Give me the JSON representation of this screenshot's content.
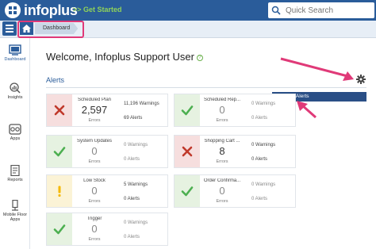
{
  "header": {
    "logo_text": "infoplus",
    "get_started": ">> Get Started",
    "search_placeholder": "Quick Search"
  },
  "breadcrumb": {
    "current": "Dashboard"
  },
  "sidebar": {
    "items": [
      {
        "label": "Dashboard",
        "icon": "dashboard-icon",
        "active": true
      },
      {
        "label": "Insights",
        "icon": "insights-icon"
      },
      {
        "label": "Apps",
        "icon": "apps-icon"
      },
      {
        "label": "Reports",
        "icon": "reports-icon"
      },
      {
        "label": "Mobile Floor Apps",
        "icon": "mobile-floor-icon"
      }
    ]
  },
  "main": {
    "welcome": "Welcome, Infoplus Support User",
    "section_title": "Alerts",
    "manage_alerts": "Manage Alerts"
  },
  "colors": {
    "brand": "#2a5c9a",
    "accent_green": "#8fd35a",
    "error": "#c0392b",
    "ok": "#4caf50",
    "warn": "#f5b800",
    "highlight": "#e03a78"
  },
  "cards": [
    {
      "name": "Scheduled Plan",
      "count": "2,597",
      "count_label": "Errors",
      "warnings": "11,196 Warnings",
      "alerts": "69 Alerts",
      "status": "error"
    },
    {
      "name": "Scheduled Rep...",
      "count": "0",
      "count_label": "Errors",
      "warnings": "0 Warnings",
      "alerts": "0 Alerts",
      "status": "ok"
    },
    {
      "name": "System Updates",
      "count": "0",
      "count_label": "Errors",
      "warnings": "0 Warnings",
      "alerts": "0 Alerts",
      "status": "ok"
    },
    {
      "name": "Shopping Cart ...",
      "count": "8",
      "count_label": "Errors",
      "warnings": "0 Warnings",
      "alerts": "0 Alerts",
      "status": "error"
    },
    {
      "name": "Low Stock",
      "count": "0",
      "count_label": "Errors",
      "warnings": "5 Warnings",
      "alerts": "0 Alerts",
      "status": "warn"
    },
    {
      "name": "Order Confirma...",
      "count": "0",
      "count_label": "Errors",
      "warnings": "0 Warnings",
      "alerts": "0 Alerts",
      "status": "ok"
    },
    {
      "name": "Trigger",
      "count": "0",
      "count_label": "Errors",
      "warnings": "0 Warnings",
      "alerts": "0 Alerts",
      "status": "ok"
    }
  ]
}
